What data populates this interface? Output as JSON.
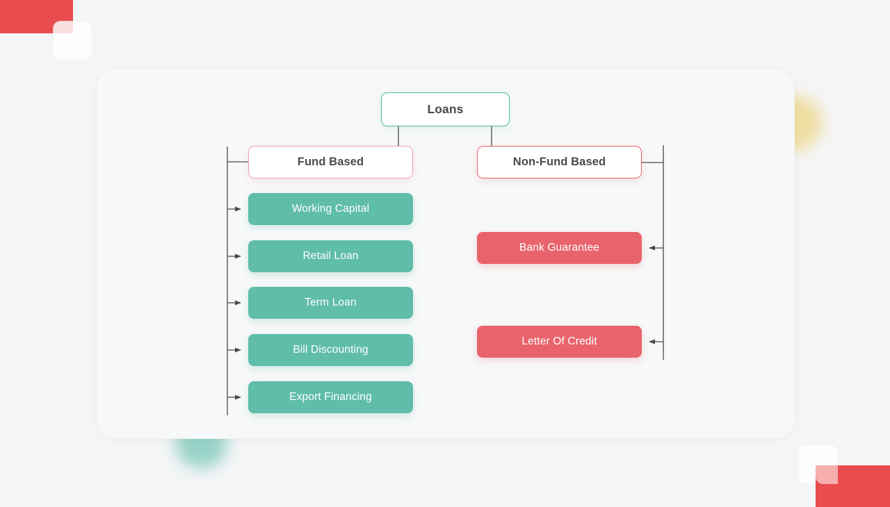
{
  "background": {
    "page_color": "#f4f5f7",
    "card_color": "#f7f8f9",
    "decor": {
      "red_color": "#ea4c4f",
      "yellow_circle_color": "#edcf6a",
      "teal_circle_color": "#5fbda9"
    }
  },
  "diagram": {
    "type": "tree",
    "root": {
      "label": "Loans",
      "text_color": "#4a4a4a",
      "border_color": "#4fb9a3",
      "fill_color": "#ffffff"
    },
    "branches": [
      {
        "label": "Fund Based",
        "border_color": "#f0a1a6",
        "fill_color": "#ffffff",
        "text_color": "#4a4a4a",
        "accent_color": "#5fbda9",
        "children": [
          {
            "label": "Working Capital"
          },
          {
            "label": "Retail Loan"
          },
          {
            "label": "Term Loan"
          },
          {
            "label": "Bill Discounting"
          },
          {
            "label": "Export Financing"
          }
        ]
      },
      {
        "label": "Non-Fund Based",
        "border_color": "#e9636c",
        "fill_color": "#ffffff",
        "text_color": "#4a4a4a",
        "accent_color": "#e9636c",
        "children": [
          {
            "label": "Bank Guarantee"
          },
          {
            "label": "Letter Of Credit"
          }
        ]
      }
    ],
    "connector_color": "#4a4a4a"
  }
}
